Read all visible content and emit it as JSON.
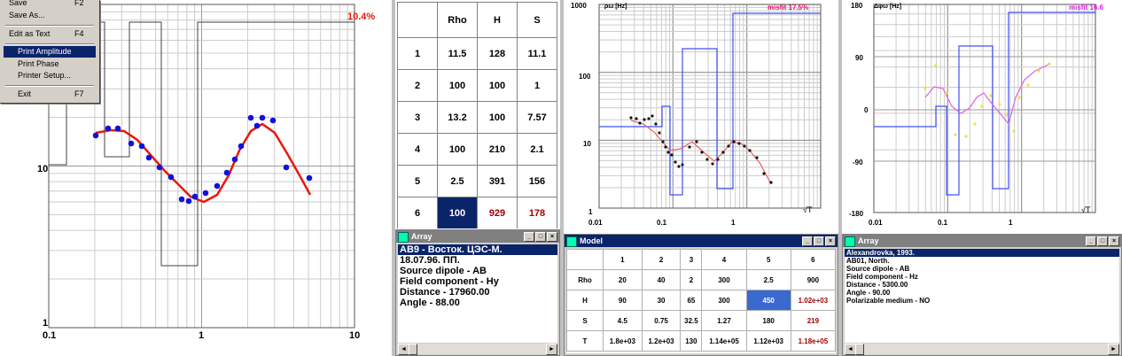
{
  "menu": {
    "items": [
      {
        "label": "Save",
        "shortcut": "F2"
      },
      {
        "label": "Save As...",
        "shortcut": ""
      },
      {
        "label": "Edit as Text",
        "shortcut": "F4"
      },
      {
        "label": "Print Amplitude",
        "shortcut": ""
      },
      {
        "label": "Print Phase",
        "shortcut": ""
      },
      {
        "label": "Printer Setup...",
        "shortcut": ""
      },
      {
        "label": "Exit",
        "shortcut": "F7"
      }
    ],
    "selected": "Print Amplitude"
  },
  "left_plot": {
    "misfit": "10.4%",
    "tick_labels": {
      "x": [
        "0.1",
        "1",
        "10"
      ],
      "y": [
        "1",
        "10"
      ]
    }
  },
  "param_table": {
    "headers": [
      "",
      "Rho",
      "H",
      "S"
    ],
    "rows": [
      [
        "1",
        "11.5",
        "128",
        "11.1"
      ],
      [
        "2",
        "100",
        "100",
        "1"
      ],
      [
        "3",
        "13.2",
        "100",
        "7.57"
      ],
      [
        "4",
        "100",
        "210",
        "2.1"
      ],
      [
        "5",
        "2.5",
        "391",
        "156"
      ],
      [
        "6",
        "100",
        "929",
        "178"
      ]
    ]
  },
  "array_window_1": {
    "title": "Array",
    "lines": [
      "AB9 - Восток. ЦЭС-М.",
      "18.07.96. ПП.",
      "Source dipole - AB",
      "Field component - Hy",
      "Distance - 17960.00",
      "Angle - 88.00"
    ]
  },
  "mid_plot": {
    "y_label": "ρω [Hz]",
    "misfit": "misfit 17.5%",
    "tick_labels": {
      "x": [
        "0.01",
        "0.1",
        "1"
      ],
      "y": [
        "1",
        "10",
        "100",
        "1000"
      ]
    },
    "sqrtT": "√T"
  },
  "right_plot": {
    "y_label": "Δφω [Hz]",
    "misfit": "misfit 16.6",
    "tick_labels": {
      "x": [
        "0.01",
        "0.1",
        "1"
      ],
      "y": [
        "-180",
        "-90",
        "0",
        "90",
        "180"
      ]
    },
    "sqrtT": "√T"
  },
  "model_window": {
    "title": "Model",
    "columns": [
      "",
      "1",
      "2",
      "3",
      "4",
      "5",
      "6"
    ],
    "rows": [
      [
        "Rho",
        "20",
        "40",
        "2",
        "300",
        "2.5",
        "900"
      ],
      [
        "H",
        "90",
        "30",
        "65",
        "300",
        "450",
        "1.02e+03"
      ],
      [
        "S",
        "4.5",
        "0.75",
        "32.5",
        "1.27",
        "180",
        "219"
      ],
      [
        "T",
        "1.8e+03",
        "1.2e+03",
        "130",
        "1.14e+05",
        "1.12e+03",
        "1.18e+05"
      ]
    ]
  },
  "array_window_2": {
    "title": "Array",
    "lines": [
      "Alexandrovka, 1993.",
      "AB01, North.",
      "Source dipole - AB",
      "Field component - Hz",
      "Distance - 5300.00",
      "Angle - 90.00",
      "Polarizable medium - NO"
    ]
  },
  "colors": {
    "selection": "#0a246a",
    "fit_curve": "#e8180c",
    "data_points": "#1010e0",
    "model_line": "#4050f0",
    "misfit_mid": "#e01060",
    "misfit_right": "#e020e0",
    "value_red": "#a00000"
  }
}
